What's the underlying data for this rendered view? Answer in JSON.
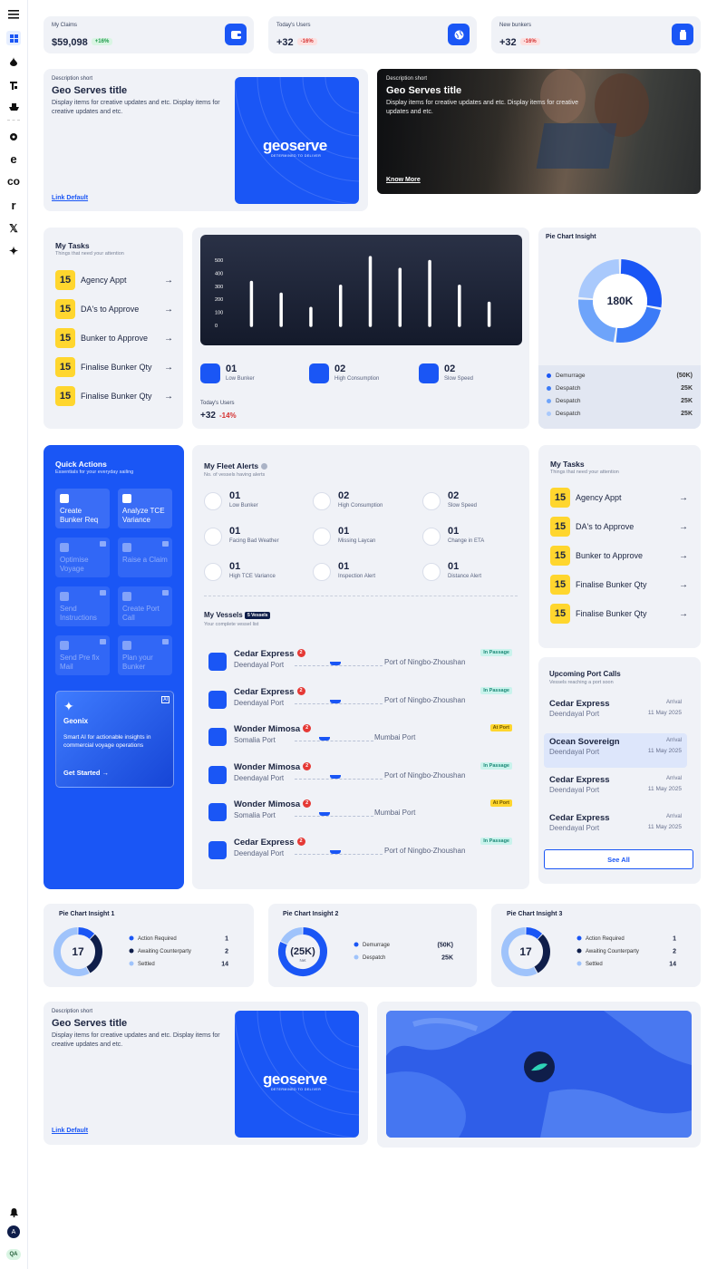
{
  "sidebar": {
    "avatar_letter": "A",
    "avatar_bottom": "QA"
  },
  "stats": [
    {
      "label": "My Claims",
      "value": "$59,098",
      "change": "+16%",
      "trend": "up"
    },
    {
      "label": "Today's Users",
      "value": "+32",
      "change": "-16%",
      "trend": "down"
    },
    {
      "label": "New bunkers",
      "value": "+32",
      "change": "-16%",
      "trend": "down"
    }
  ],
  "promo1": {
    "eyebrow": "Description short",
    "title": "Geo Serves title",
    "body": "Display items for creative updates and etc. Display items for creative updates and etc.",
    "link": "Link Default",
    "logo": "geoserve",
    "logo_tag": "DETERMINED TO DELIVER"
  },
  "promo2": {
    "eyebrow": "Description short",
    "title": "Geo Serves title",
    "body": "Display items for creative updates and etc. Display items for creative updates and etc.",
    "link": "Know More"
  },
  "tasks1": {
    "title": "My Tasks",
    "subtitle": "Things that need your attention",
    "items": [
      {
        "num": "15",
        "label": "Agency Appt"
      },
      {
        "num": "15",
        "label": "DA's to Approve"
      },
      {
        "num": "15",
        "label": "Bunker to Approve"
      },
      {
        "num": "15",
        "label": "Finalise Bunker Qty"
      },
      {
        "num": "15",
        "label": "Finalise Bunker Qty"
      }
    ]
  },
  "chart_data": [
    {
      "type": "bar",
      "ylim": [
        0,
        500
      ],
      "yticks": [
        "500",
        "400",
        "300",
        "200",
        "100",
        "0"
      ],
      "values": [
        330,
        240,
        130,
        300,
        520,
        430,
        490,
        300,
        170
      ],
      "title": "",
      "xlabel": "",
      "ylabel": ""
    },
    {
      "type": "pie",
      "title": "Pie Chart Insight",
      "center": "180K",
      "slices": [
        {
          "name": "Demurrage",
          "value": "(50K)",
          "frac": 0.28,
          "color": "#1a56f5"
        },
        {
          "name": "Despatch",
          "value": "25K",
          "frac": 0.24,
          "color": "#3b7bf7"
        },
        {
          "name": "Despatch",
          "value": "25K",
          "frac": 0.24,
          "color": "#6ea4fa"
        },
        {
          "name": "Despatch",
          "value": "25K",
          "frac": 0.24,
          "color": "#a9c9fc"
        }
      ]
    },
    {
      "type": "pie",
      "title": "Pie Chart Insight 1",
      "center": "17",
      "slices": [
        {
          "name": "Action Required",
          "value": "1",
          "frac": 0.12,
          "color": "#1a56f5"
        },
        {
          "name": "Awaiting Counterparty",
          "value": "2",
          "frac": 0.3,
          "color": "#0f1e4a"
        },
        {
          "name": "Settled",
          "value": "14",
          "frac": 0.58,
          "color": "#9fc3fb"
        }
      ]
    },
    {
      "type": "pie",
      "title": "Pie Chart Insight 2",
      "center": "(25K)",
      "center_sub": "Net",
      "slices": [
        {
          "name": "Demurrage",
          "value": "(50K)",
          "frac": 0.82,
          "color": "#1a56f5"
        },
        {
          "name": "Despatch",
          "value": "25K",
          "frac": 0.18,
          "color": "#9fc3fb"
        }
      ]
    },
    {
      "type": "pie",
      "title": "Pie Chart Insight 3",
      "center": "17",
      "slices": [
        {
          "name": "Action Required",
          "value": "1",
          "frac": 0.12,
          "color": "#1a56f5"
        },
        {
          "name": "Awaiting Counterparty",
          "value": "2",
          "frac": 0.3,
          "color": "#0f1e4a"
        },
        {
          "name": "Settled",
          "value": "14",
          "frac": 0.58,
          "color": "#9fc3fb"
        }
      ]
    }
  ],
  "bar_stats": [
    {
      "num": "01",
      "label": "Low Bunker"
    },
    {
      "num": "02",
      "label": "High Consumption"
    },
    {
      "num": "02",
      "label": "Slow Speed"
    }
  ],
  "today_users": {
    "label": "Today's Users",
    "value": "+32",
    "change": "-14%"
  },
  "quick_actions": {
    "title": "Quick Actions",
    "subtitle": "Essentials for your everyday sailing",
    "tiles": [
      {
        "label": "Create Bunker Req",
        "enabled": true
      },
      {
        "label": "Analyze TCE Variance",
        "enabled": true
      },
      {
        "label": "Optimise Voyage",
        "enabled": false
      },
      {
        "label": "Raise a Claim",
        "enabled": false
      },
      {
        "label": "Send Instructions",
        "enabled": false
      },
      {
        "label": "Create Port Call",
        "enabled": false
      },
      {
        "label": "Send Pre fix Mail",
        "enabled": false
      },
      {
        "label": "Plan your Bunker",
        "enabled": false
      }
    ],
    "geonix": {
      "name": "Geonix",
      "badge": "AI",
      "body": "Smart AI for actionable insights in commercial voyage operations",
      "cta": "Get Started →"
    }
  },
  "fleet_alerts": {
    "title": "My Fleet Alerts",
    "subtitle": "No. of vessels having alerts",
    "items": [
      {
        "num": "01",
        "label": "Low Bunker",
        "icon": "fuel-icon"
      },
      {
        "num": "02",
        "label": "High Consumption",
        "icon": "gauge-icon"
      },
      {
        "num": "02",
        "label": "Slow Speed",
        "icon": "speed-icon"
      },
      {
        "num": "01",
        "label": "Facing Bad Weather",
        "icon": "weather-icon"
      },
      {
        "num": "01",
        "label": "Missing Laycan",
        "icon": "calendar-icon"
      },
      {
        "num": "01",
        "label": "Change in ETA",
        "icon": "clock-icon"
      },
      {
        "num": "01",
        "label": "High TCE Variance",
        "icon": "dollar-icon"
      },
      {
        "num": "01",
        "label": "Inspection Alert",
        "icon": "eye-icon"
      },
      {
        "num": "01",
        "label": "Distance Alert",
        "icon": "route-icon"
      }
    ]
  },
  "vessels": {
    "title": "My Vessels",
    "count": "5 Vessels",
    "subtitle": "Your complete vessel list",
    "items": [
      {
        "name": "Cedar Express",
        "badge": "2",
        "from": "Deendayal Port",
        "to": "Port of Ningbo-Zhoushan",
        "status": "In Passage",
        "kind": "p"
      },
      {
        "name": "Cedar Express",
        "badge": "2",
        "from": "Deendayal Port",
        "to": "Port of Ningbo-Zhoushan",
        "status": "In Passage",
        "kind": "p"
      },
      {
        "name": "Wonder Mimosa",
        "badge": "2",
        "from": "Somalia Port",
        "to": "Mumbai Port",
        "status": "At Port",
        "kind": "a"
      },
      {
        "name": "Wonder Mimosa",
        "badge": "2",
        "from": "Deendayal Port",
        "to": "Port of Ningbo-Zhoushan",
        "status": "In Passage",
        "kind": "p"
      },
      {
        "name": "Wonder Mimosa",
        "badge": "2",
        "from": "Somalia Port",
        "to": "Mumbai Port",
        "status": "At Port",
        "kind": "a"
      },
      {
        "name": "Cedar Express",
        "badge": "2",
        "from": "Deendayal Port",
        "to": "Port of Ningbo-Zhoushan",
        "status": "In Passage",
        "kind": "p"
      }
    ]
  },
  "tasks2": {
    "title": "My Tasks",
    "subtitle": "Things that need your attention",
    "items": [
      {
        "num": "15",
        "label": "Agency Appt"
      },
      {
        "num": "15",
        "label": "DA's to Approve"
      },
      {
        "num": "15",
        "label": "Bunker to Approve"
      },
      {
        "num": "15",
        "label": "Finalise Bunker Qty"
      },
      {
        "num": "15",
        "label": "Finalise Bunker Qty"
      }
    ]
  },
  "port_calls": {
    "title": "Upcoming Port Calls",
    "subtitle": "Vessels reaching a port soon",
    "see_all": "See All",
    "items": [
      {
        "name": "Cedar Express",
        "port": "Deendayal Port",
        "arr": "Arrival",
        "date": "11 May 2025"
      },
      {
        "name": "Ocean Sovereign",
        "port": "Deendayal Port",
        "arr": "Arrival",
        "date": "11 May 2025"
      },
      {
        "name": "Cedar Express",
        "port": "Deendayal Port",
        "arr": "Arrival",
        "date": "11 May 2025"
      },
      {
        "name": "Cedar Express",
        "port": "Deendayal Port",
        "arr": "Arrival",
        "date": "11 May 2025"
      }
    ]
  },
  "promo3": {
    "eyebrow": "Description short",
    "title": "Geo Serves title",
    "body": "Display items for creative updates and etc. Display items for creative updates and etc.",
    "link": "Link Default",
    "logo": "geoserve",
    "logo_tag": "DETERMINED TO DELIVER"
  }
}
